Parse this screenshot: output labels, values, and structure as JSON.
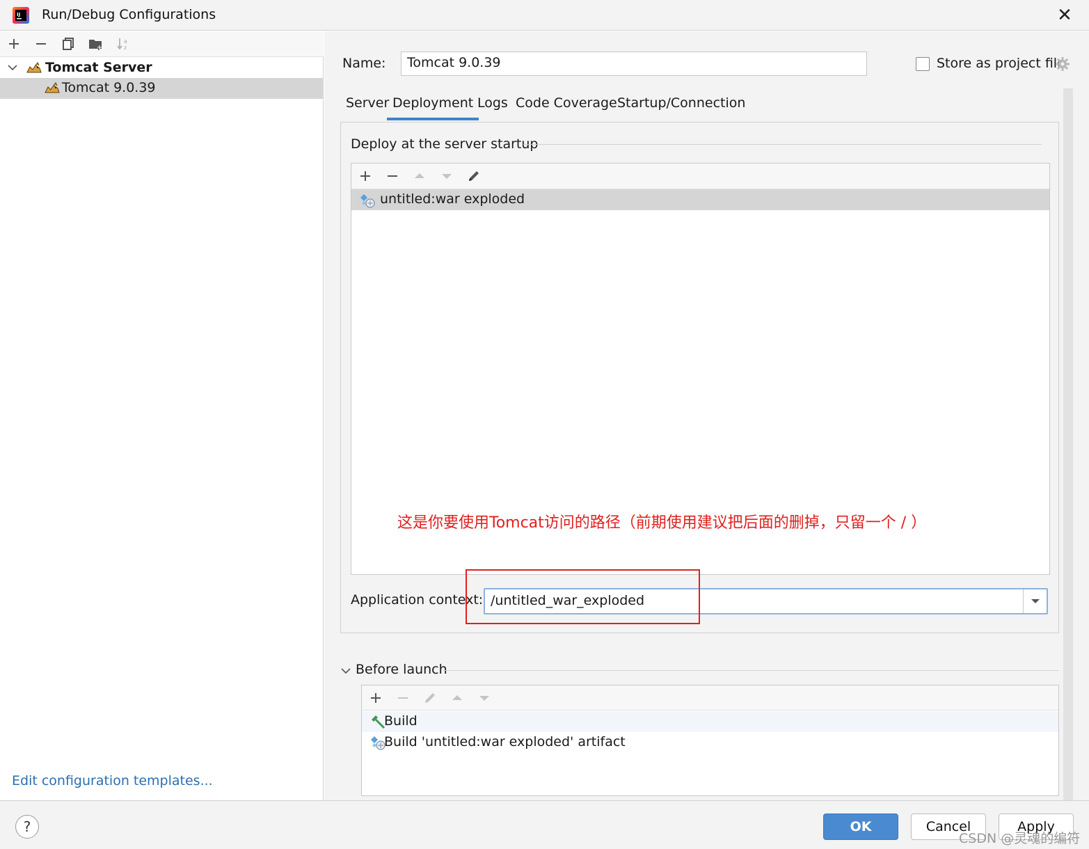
{
  "window": {
    "title": "Run/Debug Configurations"
  },
  "tree": {
    "group_label": "Tomcat Server",
    "item_label": "Tomcat 9.0.39"
  },
  "left": {
    "edit_templates": "Edit configuration templates..."
  },
  "form": {
    "name_label": "Name:",
    "name_value": "Tomcat 9.0.39",
    "store_label": "Store as project file",
    "store_checked": false
  },
  "tabs": [
    "Server",
    "Deployment",
    "Logs",
    "Code Coverage",
    "Startup/Connection"
  ],
  "active_tab": "Deployment",
  "deploy": {
    "section_title": "Deploy at the server startup",
    "items": [
      "untitled:war exploded"
    ],
    "annotation": "这是你要使用Tomcat访问的路径（前期使用建议把后面的删掉，只留一个 / ）",
    "context_label": "Application context:",
    "context_value": "/untitled_war_exploded"
  },
  "before_launch": {
    "title": "Before launch",
    "items": [
      "Build",
      "Build 'untitled:war exploded' artifact"
    ]
  },
  "buttons": {
    "help": "?",
    "ok": "OK",
    "cancel": "Cancel",
    "apply": "Apply"
  },
  "watermark": "CSDN @灵魂的编符",
  "colors": {
    "accent": "#4083c9",
    "annotation": "#e0201e",
    "link": "#2a6fb0"
  }
}
